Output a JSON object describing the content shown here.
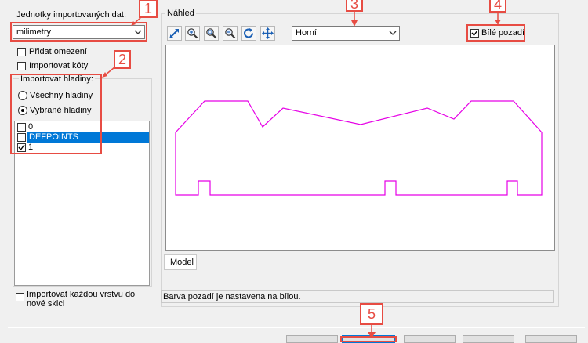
{
  "units": {
    "label": "Jednotky importovaných dat:",
    "selected": "milimetry"
  },
  "options": {
    "add_constraints": "Přidat omezení",
    "import_dimensions": "Importovat kóty"
  },
  "layers": {
    "group_label": "Importovat hladiny:",
    "all": "Všechny hladiny",
    "selected": "Vybrané hladiny",
    "items": [
      {
        "name": "0",
        "checked": false,
        "highlighted": false
      },
      {
        "name": "DEFPOINTS",
        "checked": false,
        "highlighted": true
      },
      {
        "name": "1",
        "checked": true,
        "highlighted": false
      }
    ]
  },
  "import_each_layer": "Importovat každou vrstvu do nové skici",
  "preview": {
    "label": "Náhled",
    "view_selected": "Horní",
    "white_background": "Bílé pozadí",
    "tab": "Model",
    "status": "Barva pozadí je nastavena na bílou.",
    "shape_color": "#e600e6"
  },
  "badges": [
    "1",
    "2",
    "3",
    "4",
    "5"
  ],
  "colors": {
    "annotation_red": "#e74c43",
    "selection_blue": "#0078d7"
  },
  "icons": [
    "zoom-fit-icon",
    "zoom-in-icon",
    "zoom-window-icon",
    "zoom-out-icon",
    "rotate-icon",
    "pan-icon"
  ]
}
